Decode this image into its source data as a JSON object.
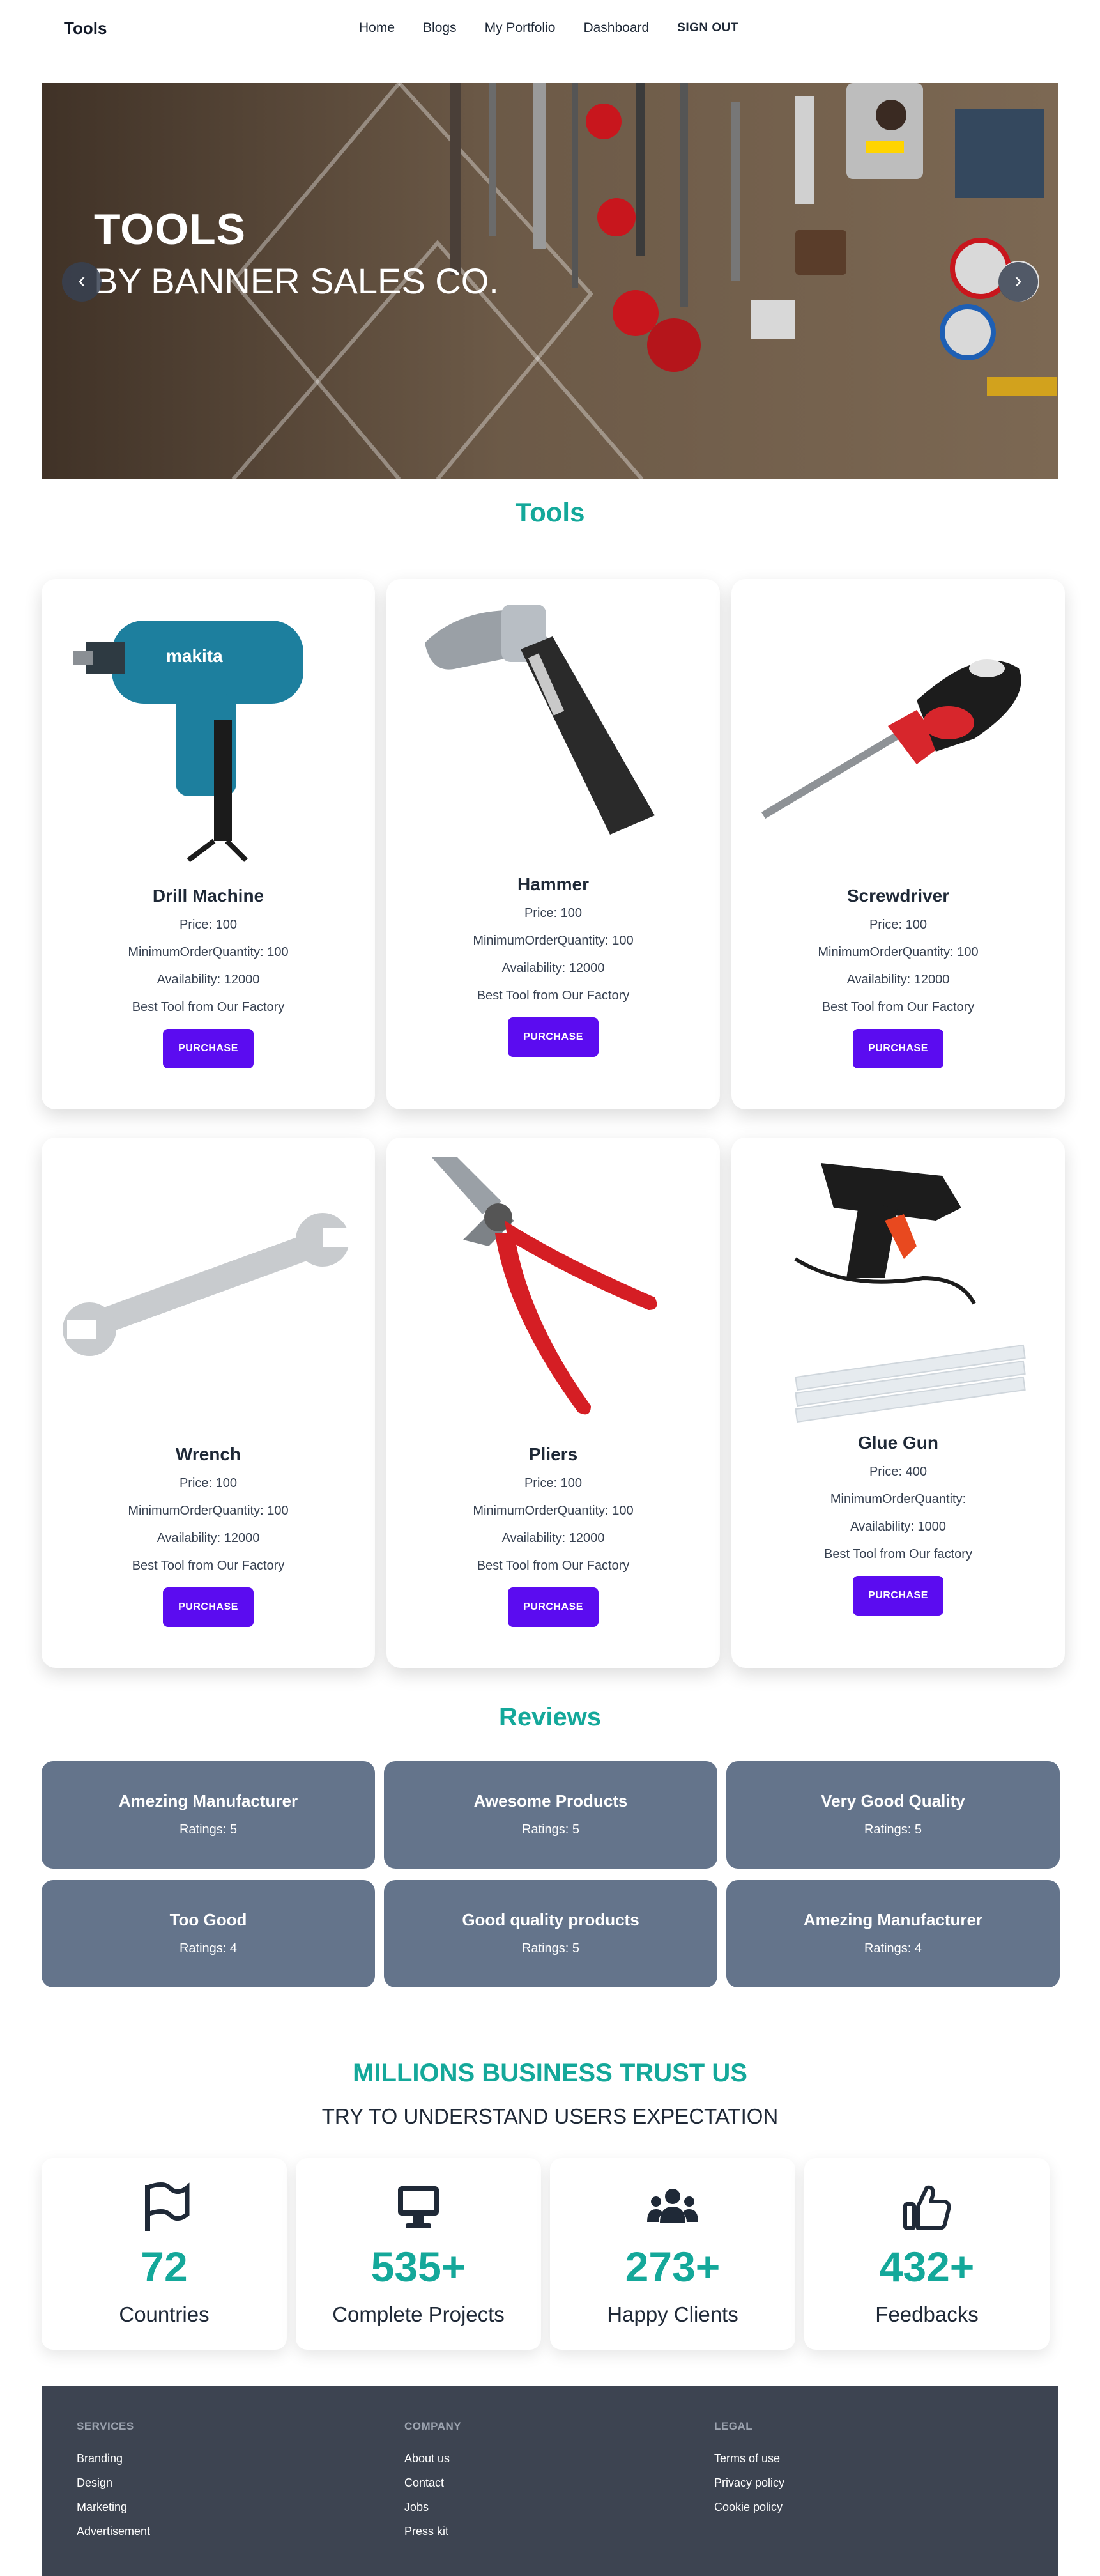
{
  "nav": {
    "brand": "Tools",
    "links": [
      "Home",
      "Blogs",
      "My Portfolio",
      "Dashboard"
    ],
    "signout": "SIGN OUT"
  },
  "hero": {
    "title": "TOOLS",
    "subtitle": "BY BANNER SALES CO.",
    "prev": "‹",
    "next": "›"
  },
  "tools_section": {
    "title": "Tools",
    "items": [
      {
        "name": "Drill Machine",
        "price": "Price: 100",
        "moq": "MinimumOrderQuantity: 100",
        "availability": "Availability: 12000",
        "desc": "Best Tool from Our Factory",
        "button": "PURCHASE"
      },
      {
        "name": "Hammer",
        "price": "Price: 100",
        "moq": "MinimumOrderQuantity: 100",
        "availability": "Availability: 12000",
        "desc": "Best Tool from Our Factory",
        "button": "PURCHASE"
      },
      {
        "name": "Screwdriver",
        "price": "Price: 100",
        "moq": "MinimumOrderQuantity: 100",
        "availability": "Availability: 12000",
        "desc": "Best Tool from Our Factory",
        "button": "PURCHASE"
      },
      {
        "name": "Wrench",
        "price": "Price: 100",
        "moq": "MinimumOrderQuantity: 100",
        "availability": "Availability: 12000",
        "desc": "Best Tool from Our Factory",
        "button": "PURCHASE"
      },
      {
        "name": "Pliers",
        "price": "Price: 100",
        "moq": "MinimumOrderQuantity: 100",
        "availability": "Availability: 12000",
        "desc": "Best Tool from Our Factory",
        "button": "PURCHASE"
      },
      {
        "name": "Glue Gun",
        "price": "Price: 400",
        "moq": "MinimumOrderQuantity:",
        "availability": "Availability: 1000",
        "desc": "Best Tool from Our factory",
        "button": "PURCHASE"
      }
    ]
  },
  "reviews": {
    "title": "Reviews",
    "items": [
      {
        "title": "Amezing Manufacturer",
        "rating": "Ratings: 5"
      },
      {
        "title": "Awesome Products",
        "rating": "Ratings: 5"
      },
      {
        "title": "Very Good Quality",
        "rating": "Ratings: 5"
      },
      {
        "title": "Too Good",
        "rating": "Ratings: 4"
      },
      {
        "title": "Good quality products",
        "rating": "Ratings: 5"
      },
      {
        "title": "Amezing Manufacturer",
        "rating": "Ratings: 4"
      }
    ]
  },
  "trust": {
    "title": "MILLIONS BUSINESS TRUST US",
    "subtitle": "TRY TO UNDERSTAND USERS EXPECTATION",
    "stats": [
      {
        "icon": "flag-icon",
        "value": "72",
        "label": "Countries"
      },
      {
        "icon": "desktop-icon",
        "value": "535+",
        "label": "Complete Projects"
      },
      {
        "icon": "users-icon",
        "value": "273+",
        "label": "Happy Clients"
      },
      {
        "icon": "thumbs-up-icon",
        "value": "432+",
        "label": "Feedbacks"
      }
    ]
  },
  "footer": {
    "services": {
      "heading": "SERVICES",
      "links": [
        "Branding",
        "Design",
        "Marketing",
        "Advertisement"
      ]
    },
    "company": {
      "heading": "COMPANY",
      "links": [
        "About us",
        "Contact",
        "Jobs",
        "Press kit"
      ]
    },
    "legal": {
      "heading": "LEGAL",
      "links": [
        "Terms of use",
        "Privacy policy",
        "Cookie policy"
      ]
    }
  },
  "colors": {
    "accent": "#14a89a",
    "button": "#5b0cf0",
    "review_card": "#64748b",
    "footer": "#3d4451"
  }
}
